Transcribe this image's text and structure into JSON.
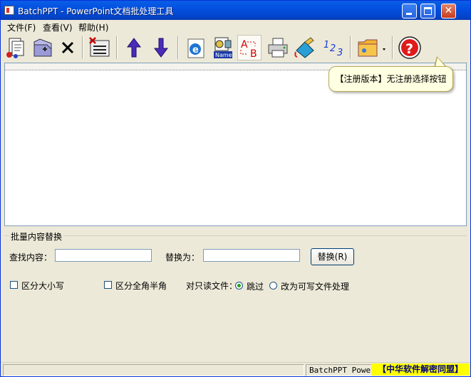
{
  "window": {
    "title": "BatchPPT - PowerPoint文档批处理工具"
  },
  "menu": {
    "items": [
      {
        "label": "文件(F)"
      },
      {
        "label": "查看(V)"
      },
      {
        "label": "帮助(H)"
      }
    ]
  },
  "toolbar": {
    "icons": [
      "add-files-icon",
      "add-folder-icon",
      "remove-icon",
      "clear-list-icon",
      "move-up-icon",
      "move-down-icon",
      "web-icon",
      "name-icon",
      "replace-ab-icon",
      "print-icon",
      "paint-icon",
      "numbering-icon",
      "folder-menu-icon",
      "help-icon"
    ],
    "name_badge": "Name",
    "numbering_label": "1 2 3",
    "ab_label_a": "A",
    "ab_label_b": "B"
  },
  "tooltip": {
    "text": "【注册版本】无注册选择按钮"
  },
  "replace": {
    "group_label": "批量内容替换",
    "find_label": "查找内容：",
    "find_value": "",
    "replace_label": "替换为：",
    "replace_value": "",
    "button_label": "替换(R)",
    "case_label": "区分大小写",
    "width_label": "区分全角半角",
    "readonly_label": "对只读文件：",
    "skip_label": "跳过",
    "writable_label": "改为可写文件处理"
  },
  "status": {
    "text": "BatchPPT PowerP",
    "brand": "【中华软件解密同盟】"
  },
  "colors": {
    "titlebar": "#0350e0",
    "tooltip_bg": "#ffffe1",
    "brand_bg": "#ffff00",
    "brand_text": "#000080"
  }
}
